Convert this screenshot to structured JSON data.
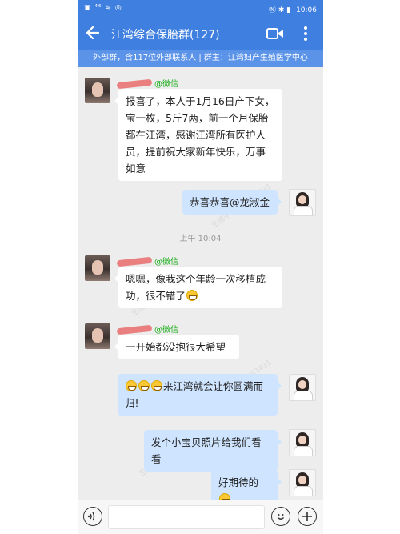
{
  "status_bar": {
    "left_icons": "▣ ⁴⁶ ≋ ◎",
    "right_icons": "Ⓝ ✱ ▮",
    "time": "10:06"
  },
  "header": {
    "title": "江湾综合保胎群(127)",
    "back_icon": "back-arrow-icon",
    "video_icon": "video-call-icon",
    "more_icon": "more-vertical-icon"
  },
  "group_info": "外部群，含117位外部联系人 | 群主：江湾妇产生殖医学中心",
  "messages": [
    {
      "from": "left",
      "name_suffix": "@微信",
      "text": "报喜了，本人于1月16日产下女，宝一枚，5斤7两，前一个月保胎都在江湾，感谢江湾所有医护人员，提前祝大家新年快乐，万事如意"
    },
    {
      "from": "right",
      "text": "恭喜恭喜@龙淑金"
    },
    {
      "from": "left",
      "name_suffix": "@微信",
      "text": "嗯嗯，像我这个年龄一次移植成功，很不错了"
    },
    {
      "from": "left",
      "name_suffix": "@微信",
      "text": "一开始都没抱很大希望"
    },
    {
      "from": "right",
      "text": "来江湾就会让你圆满而归!"
    },
    {
      "from": "right",
      "text": "发个小宝贝照片给我们看看"
    },
    {
      "from": "right",
      "text": "好期待的"
    }
  ],
  "timestamp": "上午 10:04",
  "watermark": "生殖中心 管祝华1431",
  "input_bar": {
    "voice_icon": "voice-icon",
    "emoji_icon": "emoji-icon",
    "plus_icon": "plus-icon",
    "value": ""
  }
}
